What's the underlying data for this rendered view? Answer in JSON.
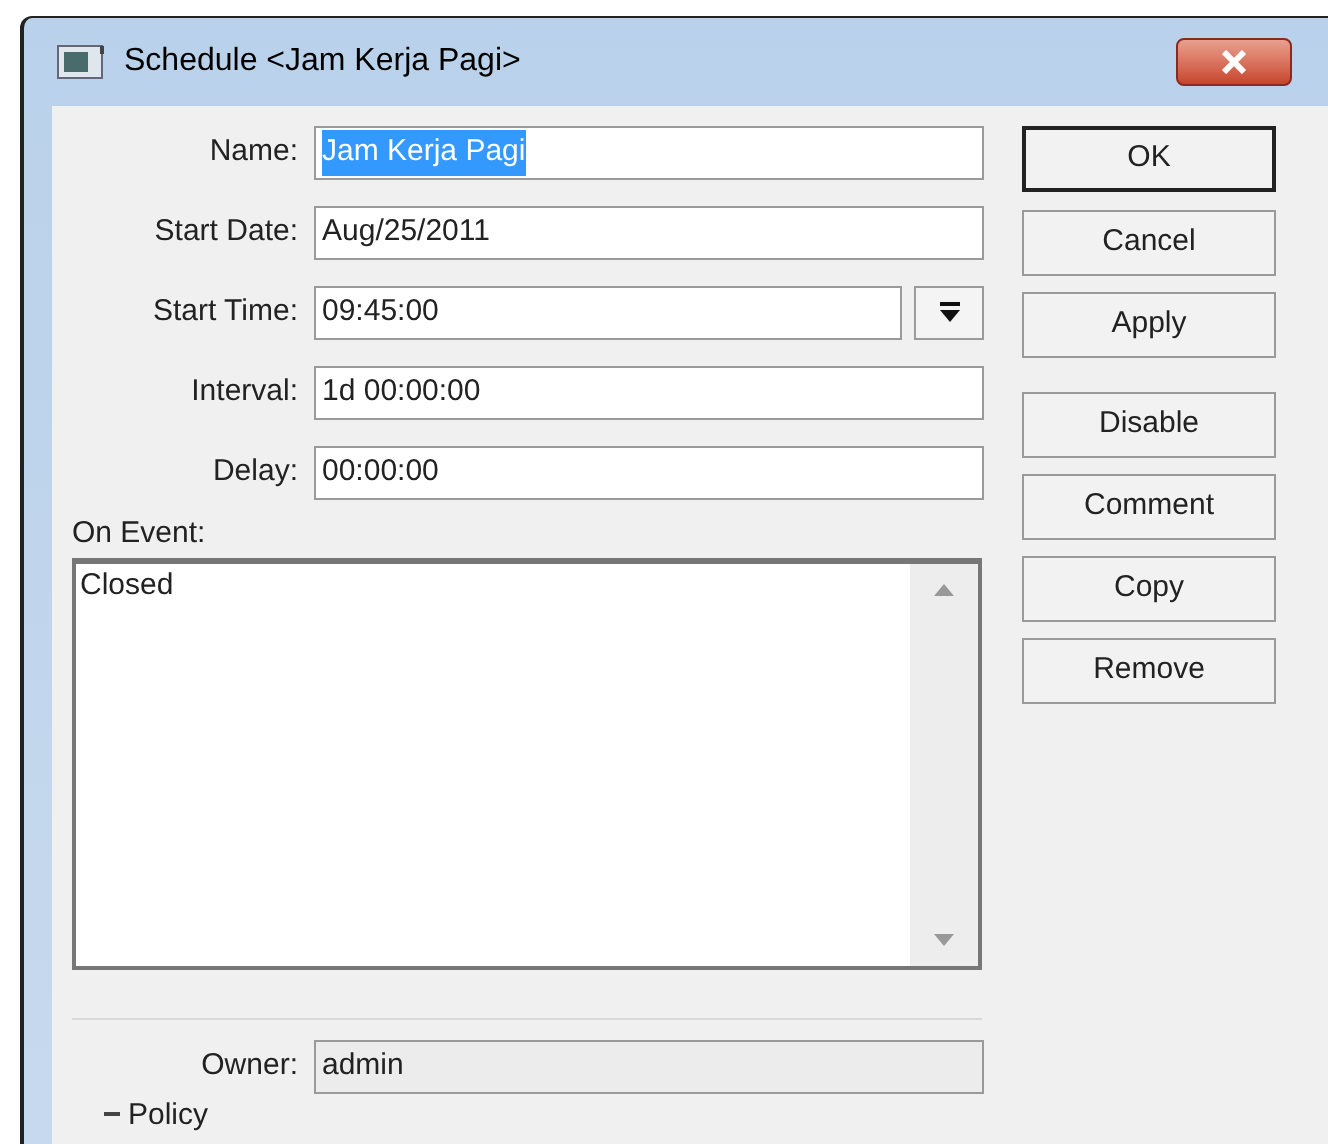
{
  "window": {
    "title": "Schedule <Jam Kerja Pagi>"
  },
  "fields": [
    {
      "label": "Name:",
      "value": "Jam Kerja Pagi",
      "selected": true,
      "kind": "text"
    },
    {
      "label": "Start Date:",
      "value": "Aug/25/2011",
      "selected": false,
      "kind": "text"
    },
    {
      "label": "Start Time:",
      "value": "09:45:00",
      "selected": false,
      "kind": "dropdown"
    },
    {
      "label": "Interval:",
      "value": "1d 00:00:00",
      "selected": false,
      "kind": "text"
    },
    {
      "label": "Delay:",
      "value": "00:00:00",
      "selected": false,
      "kind": "text"
    }
  ],
  "on_event": {
    "label": "On Event:",
    "value": "Closed"
  },
  "owner": {
    "label": "Owner:",
    "value": "admin",
    "disabled": true
  },
  "policy": {
    "label": "Policy"
  },
  "buttons": [
    {
      "label": "OK",
      "default": true
    },
    {
      "label": "Cancel",
      "default": false
    },
    {
      "label": "Apply",
      "default": false
    },
    {
      "label": "Disable",
      "default": false
    },
    {
      "label": "Comment",
      "default": false
    },
    {
      "label": "Copy",
      "default": false
    },
    {
      "label": "Remove",
      "default": false
    }
  ]
}
